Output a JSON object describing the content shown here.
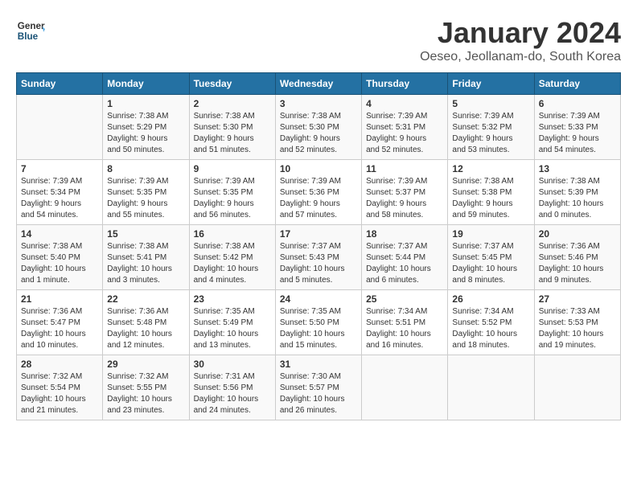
{
  "header": {
    "logo_line1": "General",
    "logo_line2": "Blue",
    "month": "January 2024",
    "location": "Oeseo, Jeollanam-do, South Korea"
  },
  "days_of_week": [
    "Sunday",
    "Monday",
    "Tuesday",
    "Wednesday",
    "Thursday",
    "Friday",
    "Saturday"
  ],
  "weeks": [
    [
      {
        "day": "",
        "info": ""
      },
      {
        "day": "1",
        "info": "Sunrise: 7:38 AM\nSunset: 5:29 PM\nDaylight: 9 hours\nand 50 minutes."
      },
      {
        "day": "2",
        "info": "Sunrise: 7:38 AM\nSunset: 5:30 PM\nDaylight: 9 hours\nand 51 minutes."
      },
      {
        "day": "3",
        "info": "Sunrise: 7:38 AM\nSunset: 5:30 PM\nDaylight: 9 hours\nand 52 minutes."
      },
      {
        "day": "4",
        "info": "Sunrise: 7:39 AM\nSunset: 5:31 PM\nDaylight: 9 hours\nand 52 minutes."
      },
      {
        "day": "5",
        "info": "Sunrise: 7:39 AM\nSunset: 5:32 PM\nDaylight: 9 hours\nand 53 minutes."
      },
      {
        "day": "6",
        "info": "Sunrise: 7:39 AM\nSunset: 5:33 PM\nDaylight: 9 hours\nand 54 minutes."
      }
    ],
    [
      {
        "day": "7",
        "info": "Sunrise: 7:39 AM\nSunset: 5:34 PM\nDaylight: 9 hours\nand 54 minutes."
      },
      {
        "day": "8",
        "info": "Sunrise: 7:39 AM\nSunset: 5:35 PM\nDaylight: 9 hours\nand 55 minutes."
      },
      {
        "day": "9",
        "info": "Sunrise: 7:39 AM\nSunset: 5:35 PM\nDaylight: 9 hours\nand 56 minutes."
      },
      {
        "day": "10",
        "info": "Sunrise: 7:39 AM\nSunset: 5:36 PM\nDaylight: 9 hours\nand 57 minutes."
      },
      {
        "day": "11",
        "info": "Sunrise: 7:39 AM\nSunset: 5:37 PM\nDaylight: 9 hours\nand 58 minutes."
      },
      {
        "day": "12",
        "info": "Sunrise: 7:38 AM\nSunset: 5:38 PM\nDaylight: 9 hours\nand 59 minutes."
      },
      {
        "day": "13",
        "info": "Sunrise: 7:38 AM\nSunset: 5:39 PM\nDaylight: 10 hours\nand 0 minutes."
      }
    ],
    [
      {
        "day": "14",
        "info": "Sunrise: 7:38 AM\nSunset: 5:40 PM\nDaylight: 10 hours\nand 1 minute."
      },
      {
        "day": "15",
        "info": "Sunrise: 7:38 AM\nSunset: 5:41 PM\nDaylight: 10 hours\nand 3 minutes."
      },
      {
        "day": "16",
        "info": "Sunrise: 7:38 AM\nSunset: 5:42 PM\nDaylight: 10 hours\nand 4 minutes."
      },
      {
        "day": "17",
        "info": "Sunrise: 7:37 AM\nSunset: 5:43 PM\nDaylight: 10 hours\nand 5 minutes."
      },
      {
        "day": "18",
        "info": "Sunrise: 7:37 AM\nSunset: 5:44 PM\nDaylight: 10 hours\nand 6 minutes."
      },
      {
        "day": "19",
        "info": "Sunrise: 7:37 AM\nSunset: 5:45 PM\nDaylight: 10 hours\nand 8 minutes."
      },
      {
        "day": "20",
        "info": "Sunrise: 7:36 AM\nSunset: 5:46 PM\nDaylight: 10 hours\nand 9 minutes."
      }
    ],
    [
      {
        "day": "21",
        "info": "Sunrise: 7:36 AM\nSunset: 5:47 PM\nDaylight: 10 hours\nand 10 minutes."
      },
      {
        "day": "22",
        "info": "Sunrise: 7:36 AM\nSunset: 5:48 PM\nDaylight: 10 hours\nand 12 minutes."
      },
      {
        "day": "23",
        "info": "Sunrise: 7:35 AM\nSunset: 5:49 PM\nDaylight: 10 hours\nand 13 minutes."
      },
      {
        "day": "24",
        "info": "Sunrise: 7:35 AM\nSunset: 5:50 PM\nDaylight: 10 hours\nand 15 minutes."
      },
      {
        "day": "25",
        "info": "Sunrise: 7:34 AM\nSunset: 5:51 PM\nDaylight: 10 hours\nand 16 minutes."
      },
      {
        "day": "26",
        "info": "Sunrise: 7:34 AM\nSunset: 5:52 PM\nDaylight: 10 hours\nand 18 minutes."
      },
      {
        "day": "27",
        "info": "Sunrise: 7:33 AM\nSunset: 5:53 PM\nDaylight: 10 hours\nand 19 minutes."
      }
    ],
    [
      {
        "day": "28",
        "info": "Sunrise: 7:32 AM\nSunset: 5:54 PM\nDaylight: 10 hours\nand 21 minutes."
      },
      {
        "day": "29",
        "info": "Sunrise: 7:32 AM\nSunset: 5:55 PM\nDaylight: 10 hours\nand 23 minutes."
      },
      {
        "day": "30",
        "info": "Sunrise: 7:31 AM\nSunset: 5:56 PM\nDaylight: 10 hours\nand 24 minutes."
      },
      {
        "day": "31",
        "info": "Sunrise: 7:30 AM\nSunset: 5:57 PM\nDaylight: 10 hours\nand 26 minutes."
      },
      {
        "day": "",
        "info": ""
      },
      {
        "day": "",
        "info": ""
      },
      {
        "day": "",
        "info": ""
      }
    ]
  ]
}
